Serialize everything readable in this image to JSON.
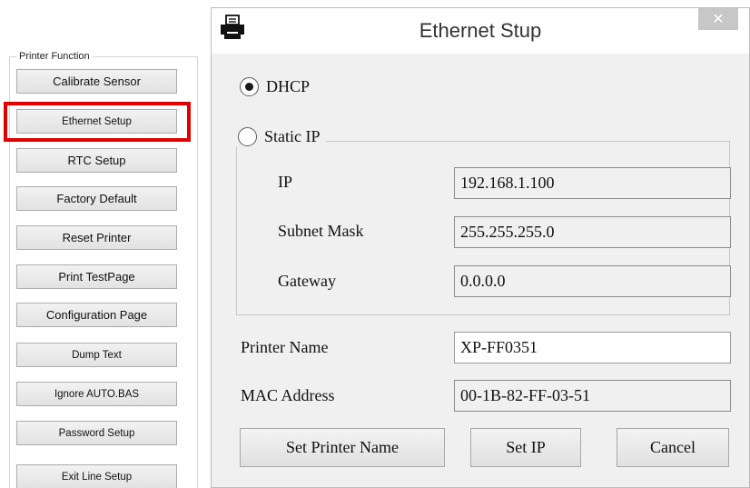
{
  "printer_function": {
    "legend": "Printer Function",
    "buttons": [
      "Calibrate Sensor",
      "Ethernet Setup",
      "RTC Setup",
      "Factory Default",
      "Reset Printer",
      "Print TestPage",
      "Configuration Page",
      "Dump Text",
      "Ignore AUTO.BAS",
      "Password Setup",
      "Exit Line Setup"
    ],
    "highlighted": "Ethernet Setup",
    "highlight_color": "#e00000"
  },
  "dialog": {
    "title": "Ethernet Stup",
    "icon": "printer-icon",
    "close_glyph": "✕",
    "dhcp_label": "DHCP",
    "dhcp_selected": true,
    "static_label": "Static IP",
    "static_selected": false,
    "ip_label": "IP",
    "ip_value": "192.168.1.100",
    "subnet_label": "Subnet Mask",
    "subnet_value": "255.255.255.0",
    "gateway_label": "Gateway",
    "gateway_value": "0.0.0.0",
    "printer_name_label": "Printer Name",
    "printer_name_value": "XP-FF0351",
    "mac_label": "MAC Address",
    "mac_value": "00-1B-82-FF-03-51",
    "set_name_button": "Set Printer Name",
    "set_ip_button": "Set IP",
    "cancel_button": "Cancel"
  }
}
